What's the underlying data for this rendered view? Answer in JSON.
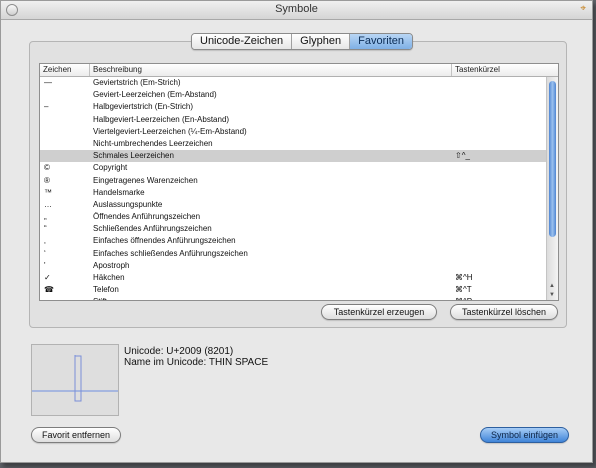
{
  "window": {
    "title": "Symbole"
  },
  "tabs": [
    {
      "label": "Unicode-Zeichen",
      "active": false
    },
    {
      "label": "Glyphen",
      "active": false
    },
    {
      "label": "Favoriten",
      "active": true
    }
  ],
  "table": {
    "headers": {
      "zeichen": "Zeichen",
      "beschreibung": "Beschreibung",
      "kuerzel": "Tastenkürzel"
    },
    "rows": [
      {
        "zeichen": "—",
        "desc": "Geviertstrich (Em-Strich)",
        "shortcut": ""
      },
      {
        "zeichen": "",
        "desc": "Geviert-Leerzeichen (Em-Abstand)",
        "shortcut": ""
      },
      {
        "zeichen": "–",
        "desc": "Halbgeviertstrich (En-Strich)",
        "shortcut": ""
      },
      {
        "zeichen": "",
        "desc": "Halbgeviert-Leerzeichen (En-Abstand)",
        "shortcut": ""
      },
      {
        "zeichen": "",
        "desc": "Viertelgeviert-Leerzeichen (¼-Em-Abstand)",
        "shortcut": ""
      },
      {
        "zeichen": "",
        "desc": "Nicht-umbrechendes Leerzeichen",
        "shortcut": ""
      },
      {
        "zeichen": "",
        "desc": "Schmales Leerzeichen",
        "shortcut": "⇧^_",
        "selected": true
      },
      {
        "zeichen": "©",
        "desc": "Copyright",
        "shortcut": ""
      },
      {
        "zeichen": "®",
        "desc": "Eingetragenes Warenzeichen",
        "shortcut": ""
      },
      {
        "zeichen": "™",
        "desc": "Handelsmarke",
        "shortcut": ""
      },
      {
        "zeichen": "…",
        "desc": "Auslassungspunkte",
        "shortcut": ""
      },
      {
        "zeichen": "„",
        "desc": "Öffnendes Anführungszeichen",
        "shortcut": ""
      },
      {
        "zeichen": "“",
        "desc": "Schließendes Anführungszeichen",
        "shortcut": ""
      },
      {
        "zeichen": "‚",
        "desc": "Einfaches öffnendes Anführungszeichen",
        "shortcut": ""
      },
      {
        "zeichen": "‘",
        "desc": "Einfaches schließendes Anführungszeichen",
        "shortcut": ""
      },
      {
        "zeichen": "'",
        "desc": "Apostroph",
        "shortcut": ""
      },
      {
        "zeichen": "✓",
        "desc": "Häkchen",
        "shortcut": "⌘^H"
      },
      {
        "zeichen": "☎",
        "desc": "Telefon",
        "shortcut": "⌘^T"
      },
      {
        "zeichen": "",
        "desc": "Stift",
        "shortcut": "⌘^P"
      }
    ]
  },
  "buttons": {
    "create_shortcut": "Tastenkürzel erzeugen",
    "delete_shortcut": "Tastenkürzel löschen",
    "remove_favorite": "Favorit entfernen",
    "insert_symbol": "Symbol einfügen"
  },
  "info": {
    "unicode": "Unicode: U+2009 (8201)",
    "name": "Name im Unicode: THIN SPACE"
  },
  "icons": {
    "close": "close-circle-icon",
    "pin": "pin-icon"
  },
  "colors": {
    "accent": "#7fb0e6",
    "selection": "#cfcfcf"
  }
}
